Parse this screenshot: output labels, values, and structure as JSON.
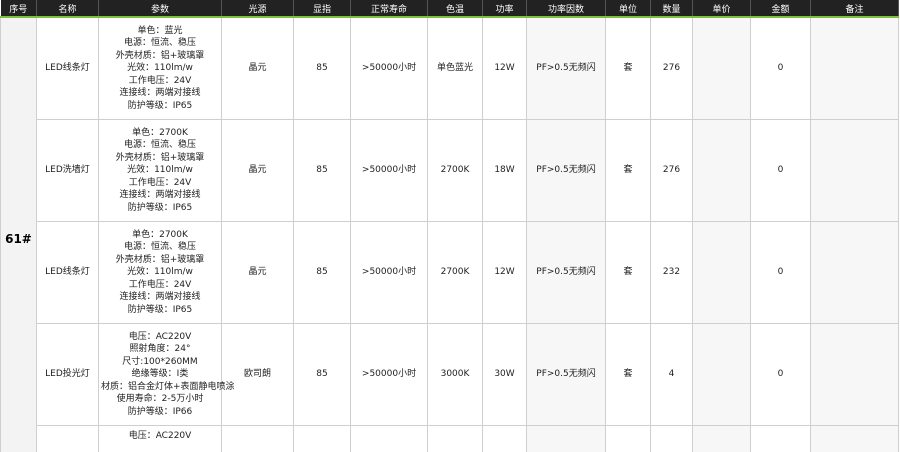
{
  "headers": [
    "序号",
    "名称",
    "参数",
    "光源",
    "显指",
    "正常寿命",
    "色温",
    "功率",
    "功率因数",
    "单位",
    "数量",
    "单价",
    "金额",
    "备注"
  ],
  "group": "61#",
  "colors": {
    "header_bg": "#222222",
    "header_text": "#ffffff",
    "header_accent": "#7fbf3f",
    "grid": "#cfcfcf"
  },
  "rows": [
    {
      "name": "LED线条灯",
      "params": [
        "单色：蓝光",
        "电源：恒流、稳压",
        "外壳材质：铝+玻璃罩",
        "光效：110lm/w",
        "工作电压：24V",
        "连接线：两端对接线",
        "防护等级：IP65"
      ],
      "source": "晶元",
      "cri": "85",
      "life": ">50000小时",
      "color": "单色蓝光",
      "power": "12W",
      "pf": "PF>0.5无频闪",
      "unit": "套",
      "qty": "276",
      "amount": "0"
    },
    {
      "name": "LED洗墙灯",
      "params": [
        "单色：2700K",
        "电源：恒流、稳压",
        "外壳材质：铝+玻璃罩",
        "光效：110lm/w",
        "工作电压：24V",
        "连接线：两端对接线",
        "防护等级：IP65"
      ],
      "source": "晶元",
      "cri": "85",
      "life": ">50000小时",
      "color": "2700K",
      "power": "18W",
      "pf": "PF>0.5无频闪",
      "unit": "套",
      "qty": "276",
      "amount": "0"
    },
    {
      "name": "LED线条灯",
      "params": [
        "单色：2700K",
        "电源：恒流、稳压",
        "外壳材质：铝+玻璃罩",
        "光效：110lm/w",
        "工作电压：24V",
        "连接线：两端对接线",
        "防护等级：IP65"
      ],
      "source": "晶元",
      "cri": "85",
      "life": ">50000小时",
      "color": "2700K",
      "power": "12W",
      "pf": "PF>0.5无频闪",
      "unit": "套",
      "qty": "232",
      "amount": "0"
    },
    {
      "name": "LED投光灯",
      "params": [
        "电压：AC220V",
        "照射角度：24°",
        "尺寸:100*260MM",
        "绝缘等级：I类",
        "材质：铝合金灯体+表面静电喷涂",
        "使用寿命：2-5万小时",
        "防护等级：IP66"
      ],
      "source": "欧司朗",
      "cri": "85",
      "life": ">50000小时",
      "color": "3000K",
      "power": "30W",
      "pf": "PF>0.5无频闪",
      "unit": "套",
      "qty": "4",
      "amount": "0"
    },
    {
      "params": [
        "电压：AC220V"
      ]
    }
  ]
}
